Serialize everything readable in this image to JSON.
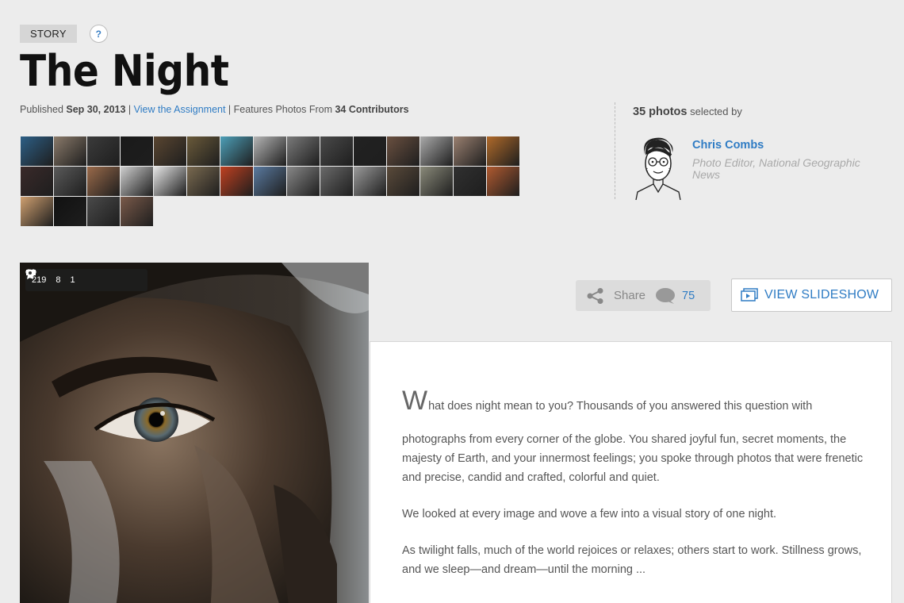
{
  "badge": {
    "label": "STORY",
    "help": "?"
  },
  "title": "The Night",
  "meta": {
    "published_prefix": "Published ",
    "published_date": "Sep 30, 2013",
    "sep1": " | ",
    "assignment_link": "View the Assignment",
    "sep2": " | Features Photos From ",
    "contributors": "34 Contributors"
  },
  "contributor_thumbs": [
    "#2d5f86",
    "#8a7a6a",
    "#3b3b3b",
    "#1a1a1a",
    "#5a4631",
    "#6a5a3a",
    "#4d9fb8",
    "#b5b5b5",
    "#7a7a7a",
    "#4a4a4a",
    "#222",
    "#6a5040",
    "#aaa",
    "#9a8070",
    "#b06a2a",
    "#3a2a2a",
    "#5a5a5a",
    "#9a6a4a",
    "#cfcfcf",
    "#e6e6e6",
    "#7a6a50",
    "#c04020",
    "#5a7aa0",
    "#888",
    "#6a6a6a",
    "#9a9a9a",
    "#5a4a3a",
    "#8a8a7a",
    "#303030",
    "#b05a30",
    "#d0a070",
    "#111",
    "#4a4a4a",
    "#7a5a4a"
  ],
  "editor": {
    "count": "35 photos",
    "selected_by": " selected by",
    "name": "Chris Combs",
    "role": "Photo Editor, National Geographic News"
  },
  "photo_stats": {
    "likes": "219",
    "comments": "8",
    "awards": "1"
  },
  "share": {
    "label": "Share",
    "comment_count": "75"
  },
  "slideshow": {
    "label": "VIEW SLIDESHOW"
  },
  "article": {
    "drop_cap": "W",
    "p1_rest": "hat does night mean to you? Thousands of you answered this question with",
    "p1_cont": "photographs from every corner of the globe. You shared joyful fun, secret moments, the majesty of Earth, and your innermost feelings; you spoke through photos that were frenetic and precise, candid and crafted, colorful and quiet.",
    "p2": "We looked at every image and wove a few into a visual story of one night.",
    "p3": "As twilight falls, much of the world rejoices or relaxes; others start to work. Stillness grows, and we sleep—and dream—until the morning ..."
  },
  "colors": {
    "link": "#2f7cc4",
    "background": "#ececec"
  },
  "icons": [
    "question-icon",
    "heart-icon",
    "comment-icon",
    "award-icon",
    "share-icon",
    "chat-bubble-icon",
    "slideshow-icon"
  ]
}
